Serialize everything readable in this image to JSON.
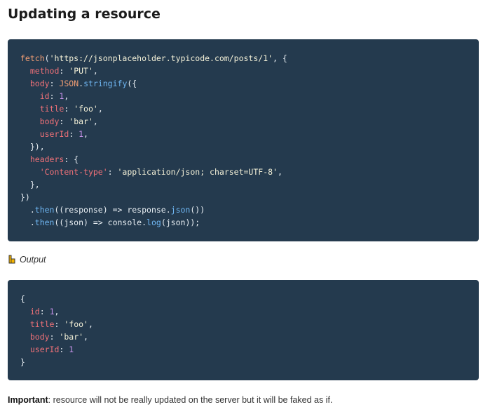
{
  "heading": "Updating a resource",
  "code_request": [
    [
      [
        "fetch",
        "fn"
      ],
      [
        "(",
        "plain"
      ],
      [
        "'https://jsonplaceholder.typicode.com/posts/1'",
        "str"
      ],
      [
        ", {",
        "plain"
      ]
    ],
    [
      [
        "  ",
        "plain"
      ],
      [
        "method",
        "key"
      ],
      [
        ": ",
        "plain"
      ],
      [
        "'PUT'",
        "str"
      ],
      [
        ",",
        "plain"
      ]
    ],
    [
      [
        "  ",
        "plain"
      ],
      [
        "body",
        "key"
      ],
      [
        ": ",
        "plain"
      ],
      [
        "JSON",
        "fn"
      ],
      [
        ".",
        "plain"
      ],
      [
        "stringify",
        "meth"
      ],
      [
        "({",
        "plain"
      ]
    ],
    [
      [
        "    ",
        "plain"
      ],
      [
        "id",
        "key"
      ],
      [
        ": ",
        "plain"
      ],
      [
        "1",
        "num"
      ],
      [
        ",",
        "plain"
      ]
    ],
    [
      [
        "    ",
        "plain"
      ],
      [
        "title",
        "key"
      ],
      [
        ": ",
        "plain"
      ],
      [
        "'foo'",
        "str"
      ],
      [
        ",",
        "plain"
      ]
    ],
    [
      [
        "    ",
        "plain"
      ],
      [
        "body",
        "key"
      ],
      [
        ": ",
        "plain"
      ],
      [
        "'bar'",
        "str"
      ],
      [
        ",",
        "plain"
      ]
    ],
    [
      [
        "    ",
        "plain"
      ],
      [
        "userId",
        "key"
      ],
      [
        ": ",
        "plain"
      ],
      [
        "1",
        "num"
      ],
      [
        ",",
        "plain"
      ]
    ],
    [
      [
        "  }),",
        "plain"
      ]
    ],
    [
      [
        "  ",
        "plain"
      ],
      [
        "headers",
        "key"
      ],
      [
        ": {",
        "plain"
      ]
    ],
    [
      [
        "    ",
        "plain"
      ],
      [
        "'Content-type'",
        "key"
      ],
      [
        ": ",
        "plain"
      ],
      [
        "'application/json; charset=UTF-8'",
        "str"
      ],
      [
        ",",
        "plain"
      ]
    ],
    [
      [
        "  },",
        "plain"
      ]
    ],
    [
      [
        "})",
        "plain"
      ]
    ],
    [
      [
        "  .",
        "plain"
      ],
      [
        "then",
        "meth"
      ],
      [
        "((response) => response.",
        "plain"
      ],
      [
        "json",
        "meth"
      ],
      [
        "())",
        "plain"
      ]
    ],
    [
      [
        "  .",
        "plain"
      ],
      [
        "then",
        "meth"
      ],
      [
        "((json) => console.",
        "plain"
      ],
      [
        "log",
        "meth"
      ],
      [
        "(json));",
        "plain"
      ]
    ]
  ],
  "output_label": "Output",
  "code_output": [
    [
      [
        "{",
        "plain"
      ]
    ],
    [
      [
        "  ",
        "plain"
      ],
      [
        "id",
        "key"
      ],
      [
        ": ",
        "plain"
      ],
      [
        "1",
        "num"
      ],
      [
        ",",
        "plain"
      ]
    ],
    [
      [
        "  ",
        "plain"
      ],
      [
        "title",
        "key"
      ],
      [
        ": ",
        "plain"
      ],
      [
        "'foo'",
        "str"
      ],
      [
        ",",
        "plain"
      ]
    ],
    [
      [
        "  ",
        "plain"
      ],
      [
        "body",
        "key"
      ],
      [
        ": ",
        "plain"
      ],
      [
        "'bar'",
        "str"
      ],
      [
        ",",
        "plain"
      ]
    ],
    [
      [
        "  ",
        "plain"
      ],
      [
        "userId",
        "key"
      ],
      [
        ": ",
        "plain"
      ],
      [
        "1",
        "num"
      ]
    ],
    [
      [
        "}",
        "plain"
      ]
    ]
  ],
  "note_strong": "Important",
  "note_text": ": resource will not be really updated on the server but it will be faked as if.",
  "colors": {
    "code_bg": "#243a4e",
    "hand_icon": "#f5b400"
  }
}
